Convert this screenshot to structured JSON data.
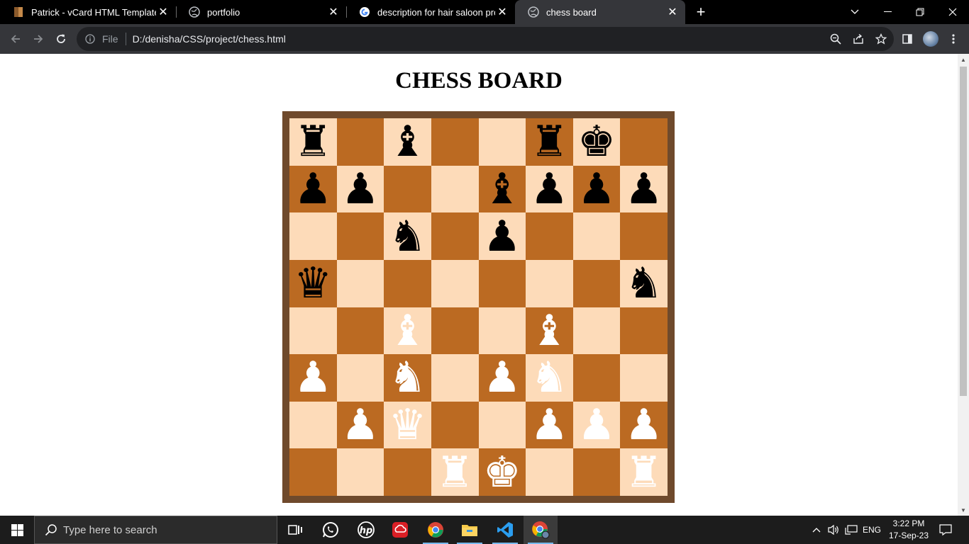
{
  "browser": {
    "tabs": [
      {
        "title": "Patrick - vCard HTML Template Pack",
        "favicon": "vcard-favicon",
        "active": false
      },
      {
        "title": "portfolio",
        "favicon": "globe-icon",
        "active": false
      },
      {
        "title": "description for hair saloon project",
        "favicon": "google-icon",
        "active": false
      },
      {
        "title": "chess board",
        "favicon": "globe-icon",
        "active": true
      }
    ],
    "new_tab_label": "+",
    "address": {
      "scheme_label": "File",
      "url": "D:/denisha/CSS/project/chess.html"
    }
  },
  "page": {
    "title": "CHESS BOARD",
    "colors": {
      "frame": "#6f4a2c",
      "light_square": "#fddbb9",
      "dark_square": "#bb6a22"
    },
    "board": [
      [
        "b-rook",
        "",
        "b-bishop",
        "",
        "",
        "b-rook",
        "b-king",
        ""
      ],
      [
        "b-pawn",
        "b-pawn",
        "",
        "",
        "b-bishop",
        "b-pawn",
        "b-pawn",
        "b-pawn"
      ],
      [
        "",
        "",
        "b-knight",
        "",
        "b-pawn",
        "",
        "",
        ""
      ],
      [
        "b-queen",
        "",
        "",
        "",
        "",
        "",
        "",
        "b-knight"
      ],
      [
        "",
        "",
        "w-bishop",
        "",
        "",
        "w-bishop",
        "",
        ""
      ],
      [
        "w-pawn",
        "",
        "w-knight",
        "",
        "w-pawn",
        "w-knight",
        "",
        ""
      ],
      [
        "",
        "w-pawn",
        "w-queen",
        "",
        "",
        "w-pawn",
        "w-pawn",
        "w-pawn"
      ],
      [
        "",
        "",
        "",
        "w-rook",
        "w-king",
        "",
        "",
        "w-rook"
      ]
    ]
  },
  "taskbar": {
    "search_placeholder": "Type here to search",
    "apps": [
      "task-view-icon",
      "whatsapp-icon",
      "hp-icon",
      "creative-cloud-icon",
      "chrome-icon",
      "file-explorer-icon",
      "vscode-icon",
      "chrome-active-icon"
    ],
    "language": "ENG",
    "time": "3:22 PM",
    "date": "17-Sep-23"
  }
}
